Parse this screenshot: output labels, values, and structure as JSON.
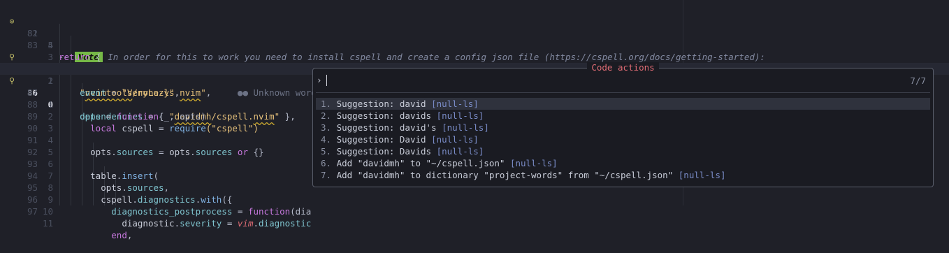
{
  "editor": {
    "lines": [
      {
        "abs": "81",
        "rel": "5",
        "sign": "target"
      },
      {
        "abs": "82",
        "rel": "4",
        "sign": ""
      },
      {
        "abs": "83",
        "rel": "3",
        "sign": ""
      },
      {
        "abs": "84",
        "rel": "2",
        "sign": "bulb"
      },
      {
        "abs": "85",
        "rel": "1",
        "sign": ""
      },
      {
        "abs": "86",
        "rel": "0",
        "sign": "bulb"
      },
      {
        "abs": "87",
        "rel": "1",
        "sign": ""
      },
      {
        "abs": "88",
        "rel": "2",
        "sign": ""
      },
      {
        "abs": "89",
        "rel": "3",
        "sign": ""
      },
      {
        "abs": "90",
        "rel": "4",
        "sign": ""
      },
      {
        "abs": "91",
        "rel": "5",
        "sign": ""
      },
      {
        "abs": "92",
        "rel": "6",
        "sign": ""
      },
      {
        "abs": "93",
        "rel": "7",
        "sign": ""
      },
      {
        "abs": "94",
        "rel": "8",
        "sign": ""
      },
      {
        "abs": "95",
        "rel": "9",
        "sign": ""
      },
      {
        "abs": "96",
        "rel": "10",
        "sign": ""
      },
      {
        "abs": "97",
        "rel": "11",
        "sign": ""
      }
    ],
    "code": {
      "l81_dash": "--",
      "l81_note": "Note",
      "l81_text": " In order for this to work you need to install cspell and create a config json file (https://cspell.org/docs/getting-started):",
      "l82_kw": "return",
      "l83_brace": "{",
      "l84_str_a": "\"",
      "l84_str_b": "nvimtools",
      "l84_str_c": "/none-ls.",
      "l84_str_d": "nvim",
      "l84_str_e": "\"",
      "l84_comma": ",",
      "l84_diag": "●● Unknown word (nvim)",
      "l85_key": "event",
      "l85_eq": " = ",
      "l85_val": "\"VeryLazy\"",
      "l85_comma": ",",
      "l86_key": "dependencies",
      "l86_eq": " = { ",
      "l86_str_a": "\"",
      "l86_str_b": "davidmh",
      "l86_str_c": "/cspell.",
      "l86_str_d": "nvim",
      "l86_str_e": "\"",
      "l86_end": " },",
      "l87_key": "opts",
      "l87_eq": " = ",
      "l87_fn": "function",
      "l87_args": "(_, opts)",
      "l88_local": "local",
      "l88_name": " cspell ",
      "l88_eq": "= ",
      "l88_req": "require",
      "l88_arg": "(\"cspell\")",
      "l90_opts": "opts",
      "l90_dot": ".",
      "l90_src": "sources",
      "l90_eq": " = ",
      "l90_opts2": "opts",
      "l90_dot2": ".",
      "l90_src2": "sources",
      "l90_or": " or ",
      "l90_tbl": "{}",
      "l92_table": "table",
      "l92_dot": ".",
      "l92_ins": "insert",
      "l92_paren": "(",
      "l93_opts": "opts",
      "l93_dot": ".",
      "l93_src": "sources",
      "l93_comma": ",",
      "l94_cs": "cspell",
      "l94_dot": ".",
      "l94_diag": "diagnostics",
      "l94_dot2": ".",
      "l94_with": "with",
      "l94_paren": "({",
      "l95_key": "diagnostics_postprocess",
      "l95_eq": " = ",
      "l95_fn": "function",
      "l95_arg": "(dia",
      "l96_d": "diagnostic",
      "l96_dot": ".",
      "l96_sev": "severity",
      "l96_eq": " = ",
      "l96_vim": "vim",
      "l96_dot2": ".",
      "l96_rest": "diagnostic",
      "l97_end": "end",
      "l97_comma": ","
    }
  },
  "popup": {
    "title": "Code actions",
    "prompt_symbol": "›",
    "counter": "7/7",
    "items": [
      {
        "num": "1.",
        "text": " Suggestion: david ",
        "source": "[null-ls]"
      },
      {
        "num": "2.",
        "text": " Suggestion: davids ",
        "source": "[null-ls]"
      },
      {
        "num": "3.",
        "text": " Suggestion: david's ",
        "source": "[null-ls]"
      },
      {
        "num": "4.",
        "text": " Suggestion: David ",
        "source": "[null-ls]"
      },
      {
        "num": "5.",
        "text": " Suggestion: Davids ",
        "source": "[null-ls]"
      },
      {
        "num": "6.",
        "text": " Add \"davidmh\" to \"~/cspell.json\" ",
        "source": "[null-ls]"
      },
      {
        "num": "7.",
        "text": " Add \"davidmh\" to dictionary \"project-words\" from \"~/cspell.json\" ",
        "source": "[null-ls]"
      }
    ]
  },
  "colors": {
    "background": "#1f2028",
    "popup_border": "#5a5e6b",
    "popup_title": "#e06c75",
    "note_badge": "#76b947"
  }
}
